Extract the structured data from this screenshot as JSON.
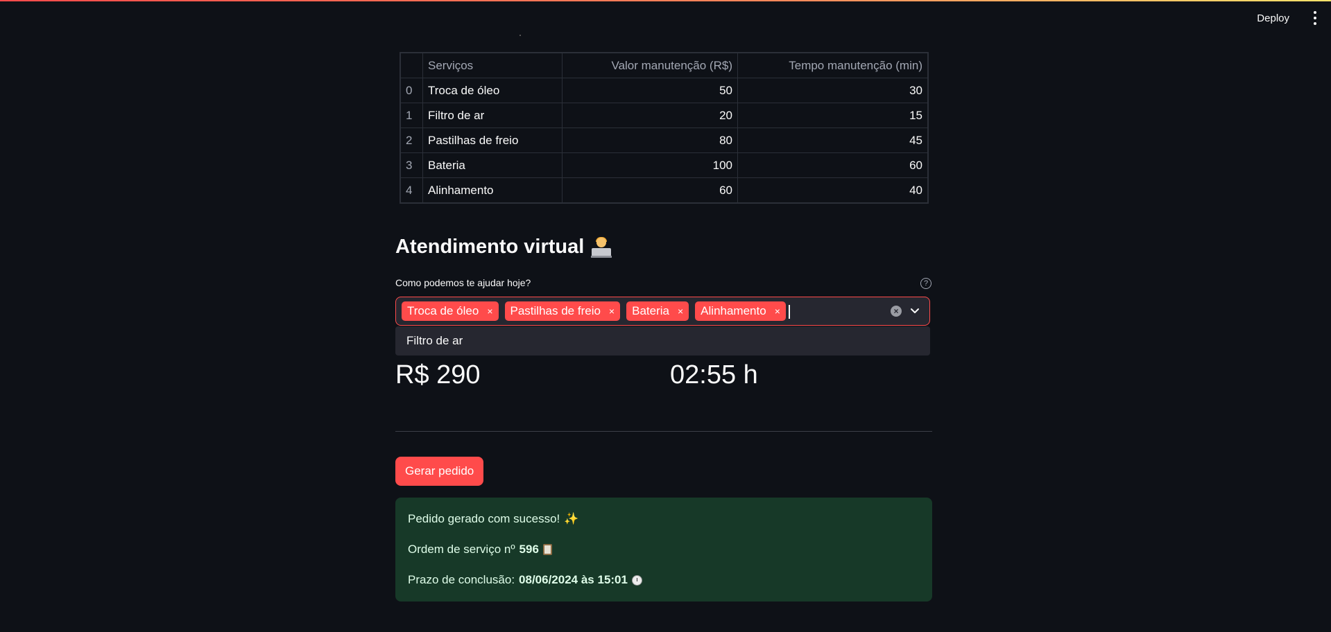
{
  "header": {
    "deploy_label": "Deploy"
  },
  "table": {
    "columns": [
      "",
      "Serviços",
      "Valor manutenção (R$)",
      "Tempo manutenção (min)"
    ],
    "rows": [
      {
        "index": "0",
        "service": "Troca de óleo",
        "value": "50",
        "time": "30"
      },
      {
        "index": "1",
        "service": "Filtro de ar",
        "value": "20",
        "time": "15"
      },
      {
        "index": "2",
        "service": "Pastilhas de freio",
        "value": "80",
        "time": "45"
      },
      {
        "index": "3",
        "service": "Bateria",
        "value": "100",
        "time": "60"
      },
      {
        "index": "4",
        "service": "Alinhamento",
        "value": "60",
        "time": "40"
      }
    ]
  },
  "section": {
    "title": "Atendimento virtual",
    "title_icon": "technologist-emoji"
  },
  "multiselect": {
    "label": "Como podemos te ajudar hoje?",
    "selected": [
      "Troca de óleo",
      "Pastilhas de freio",
      "Bateria",
      "Alinhamento"
    ],
    "remove_glyph": "×",
    "options_open": [
      "Filtro de ar"
    ],
    "accent": "#ff4b4b"
  },
  "metrics": {
    "total_value": "R$ 290",
    "total_time": "02:55 h"
  },
  "actions": {
    "generate_label": "Gerar pedido"
  },
  "result": {
    "line1": "Pedido gerado com sucesso!",
    "line2_prefix": "Ordem de serviço nº",
    "order_number": "596",
    "line3_prefix": "Prazo de conclusão:",
    "deadline": "08/06/2024 às 15:01",
    "bg_color": "#173928"
  }
}
